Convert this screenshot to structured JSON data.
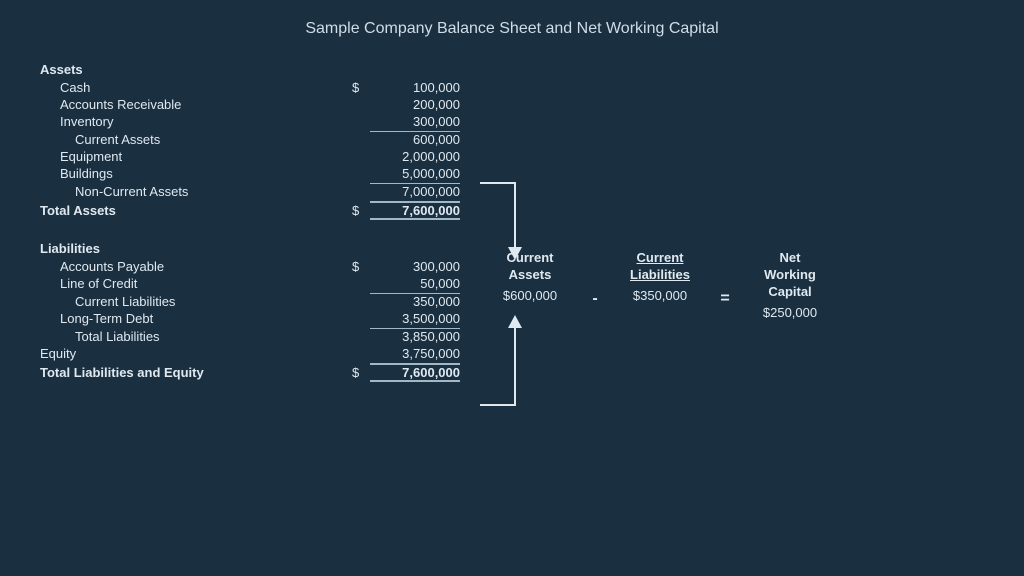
{
  "title": "Sample Company Balance Sheet and Net Working Capital",
  "assets": {
    "header": "Assets",
    "items": [
      {
        "label": "Cash",
        "dollar": "$",
        "amount": "100,000",
        "indent": 1
      },
      {
        "label": "Accounts Receivable",
        "dollar": "",
        "amount": "200,000",
        "indent": 1
      },
      {
        "label": "Inventory",
        "dollar": "",
        "amount": "300,000",
        "indent": 1
      },
      {
        "label": "Current Assets",
        "dollar": "",
        "amount": "600,000",
        "indent": 2,
        "type": "subtotal"
      },
      {
        "label": "Equipment",
        "dollar": "",
        "amount": "2,000,000",
        "indent": 1
      },
      {
        "label": "Buildings",
        "dollar": "",
        "amount": "5,000,000",
        "indent": 1
      },
      {
        "label": "Non-Current Assets",
        "dollar": "",
        "amount": "7,000,000",
        "indent": 2,
        "type": "subtotal"
      },
      {
        "label": "Total Assets",
        "dollar": "$",
        "amount": "7,600,000",
        "indent": 0,
        "type": "total"
      }
    ]
  },
  "liabilities": {
    "header": "Liabilities",
    "items": [
      {
        "label": "Accounts Payable",
        "dollar": "$",
        "amount": "300,000",
        "indent": 1
      },
      {
        "label": "Line of Credit",
        "dollar": "",
        "amount": "50,000",
        "indent": 1
      },
      {
        "label": "Current Liabilities",
        "dollar": "",
        "amount": "350,000",
        "indent": 2,
        "type": "subtotal"
      },
      {
        "label": "Long-Term Debt",
        "dollar": "",
        "amount": "3,500,000",
        "indent": 1
      },
      {
        "label": "Total Liabilities",
        "dollar": "",
        "amount": "3,850,000",
        "indent": 2,
        "type": "subtotal"
      }
    ]
  },
  "equity": {
    "label": "Equity",
    "amount": "3,750,000"
  },
  "total_liabilities_equity": {
    "label": "Total Liabilities and Equity",
    "dollar": "$",
    "amount": "7,600,000"
  },
  "diagram": {
    "current_assets": {
      "title": "Current\nAssets",
      "value": "$600,000"
    },
    "minus": "-",
    "current_liabilities": {
      "title": "Current\nLiabilities",
      "value": "$350,000",
      "underline": true
    },
    "equals": "=",
    "net_working_capital": {
      "title": "Net\nWorking\nCapital",
      "value": "$250,000"
    }
  }
}
